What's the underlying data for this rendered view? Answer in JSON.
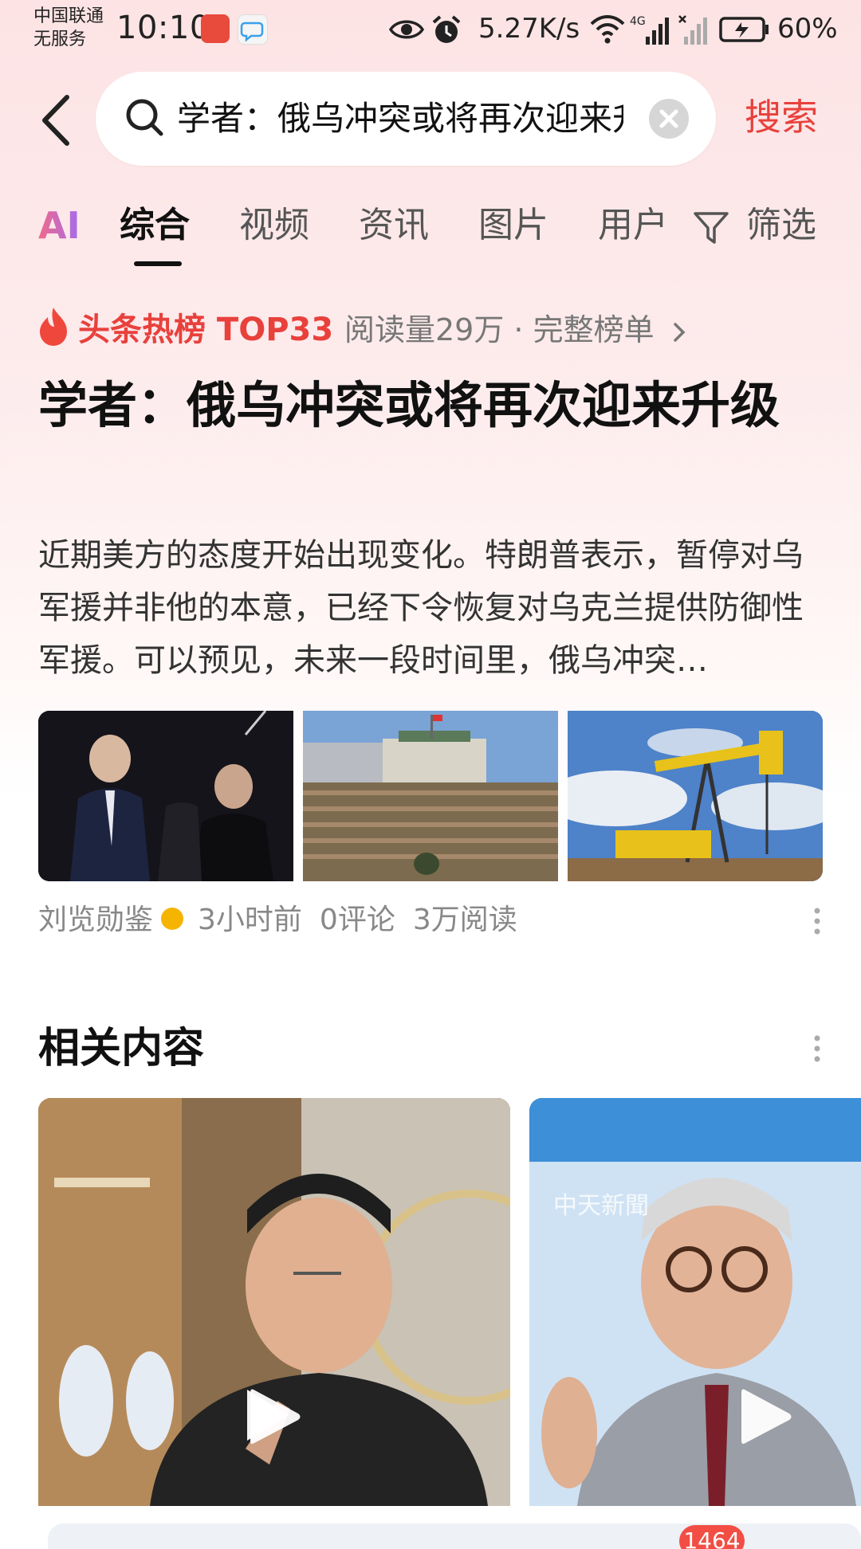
{
  "status_bar": {
    "carrier_line1": "中国联通",
    "carrier_line2": "无服务",
    "time": "10:10",
    "net_speed": "5.27K/s",
    "battery": "60%",
    "network_type": "4G"
  },
  "search": {
    "query": "学者：俄乌冲突或将再次迎来升级",
    "button_label": "搜索"
  },
  "tabs": [
    {
      "label": "AI"
    },
    {
      "label": "综合"
    },
    {
      "label": "视频"
    },
    {
      "label": "资讯"
    },
    {
      "label": "图片"
    },
    {
      "label": "用户"
    },
    {
      "label": "筛选"
    }
  ],
  "active_tab": "综合",
  "hot_list": {
    "label": "头条热榜 TOP33",
    "meta": "阅读量29万 · 完整榜单"
  },
  "article": {
    "title": "学者：俄乌冲突或将再次迎来升级",
    "summary": "近期美方的态度开始出现变化。特朗普表示，暂停对乌军援并非他的本意，已经下令恢复对乌克兰提供防御性军援。可以预见，未来一段时间里，俄乌冲突…",
    "author": "刘览勋鉴",
    "time": "3小时前",
    "comments": "0评论",
    "reads": "3万阅读"
  },
  "related": {
    "title": "相关内容",
    "video1_overlay": "",
    "video2_overlay": "中天新聞"
  },
  "bottom": {
    "badge_count": "1464"
  },
  "colors": {
    "accent_red": "#e8413c",
    "tab_active": "#111111",
    "tab_inactive": "#555555",
    "meta_gray": "#888888"
  }
}
